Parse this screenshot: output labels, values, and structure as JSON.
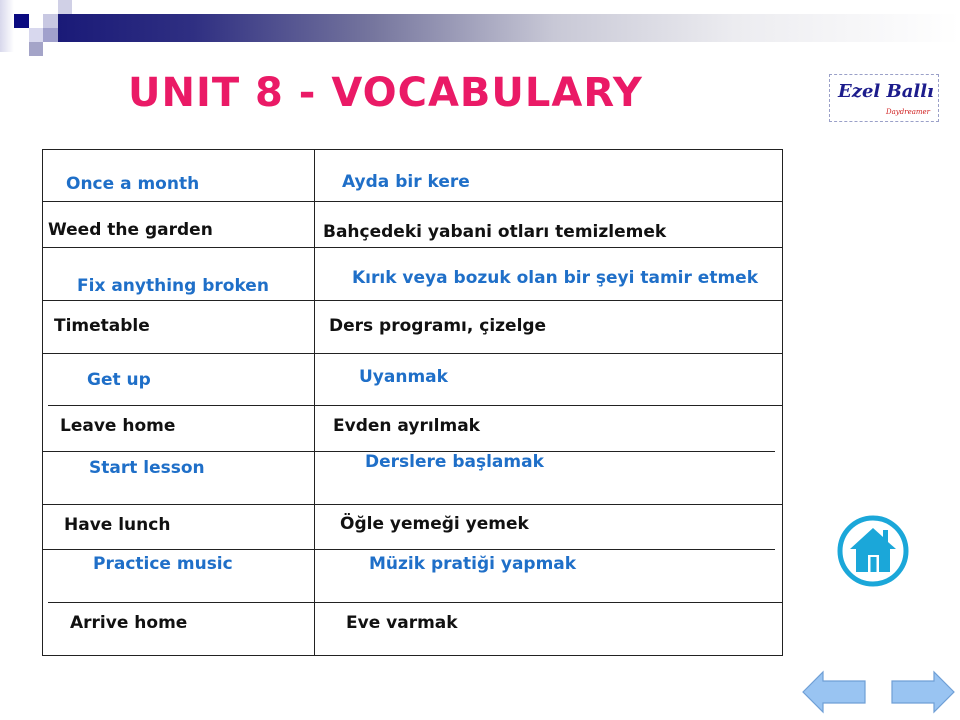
{
  "slide": {
    "title": "UNIT 8 - VOCABULARY",
    "logo": {
      "name": "Ezel Ballı",
      "tagline": "Daydreamer"
    },
    "colors": {
      "title": "#ea1a66",
      "highlight_text": "#1f6fc8",
      "normal_text": "#111111",
      "home_icon": "#1ba7d9",
      "arrow_fill": "#99c4f2"
    }
  },
  "vocabulary": [
    {
      "english": "Once a month",
      "turkish": "Ayda bir kere",
      "style": "blue"
    },
    {
      "english": "Weed the garden",
      "turkish": "Bahçedeki yabani otları temizlemek",
      "style": "black"
    },
    {
      "english": "Fix anything broken",
      "turkish": "Kırık veya bozuk olan bir şeyi tamir etmek",
      "style": "blue"
    },
    {
      "english": "Timetable",
      "turkish": "Ders programı, çizelge",
      "style": "black"
    },
    {
      "english": "Get up",
      "turkish": "Uyanmak",
      "style": "blue"
    },
    {
      "english": "Leave home",
      "turkish": "Evden ayrılmak",
      "style": "black"
    },
    {
      "english": "Start lesson",
      "turkish": "Derslere başlamak",
      "style": "blue"
    },
    {
      "english": "Have lunch",
      "turkish": "Öğle yemeği yemek",
      "style": "black"
    },
    {
      "english": "Practice music",
      "turkish": "Müzik pratiği yapmak",
      "style": "blue"
    },
    {
      "english": "Arrive home",
      "turkish": "Eve varmak",
      "style": "black"
    }
  ],
  "navigation": {
    "home": "home-icon",
    "previous": "arrow-left-icon",
    "next": "arrow-right-icon"
  }
}
